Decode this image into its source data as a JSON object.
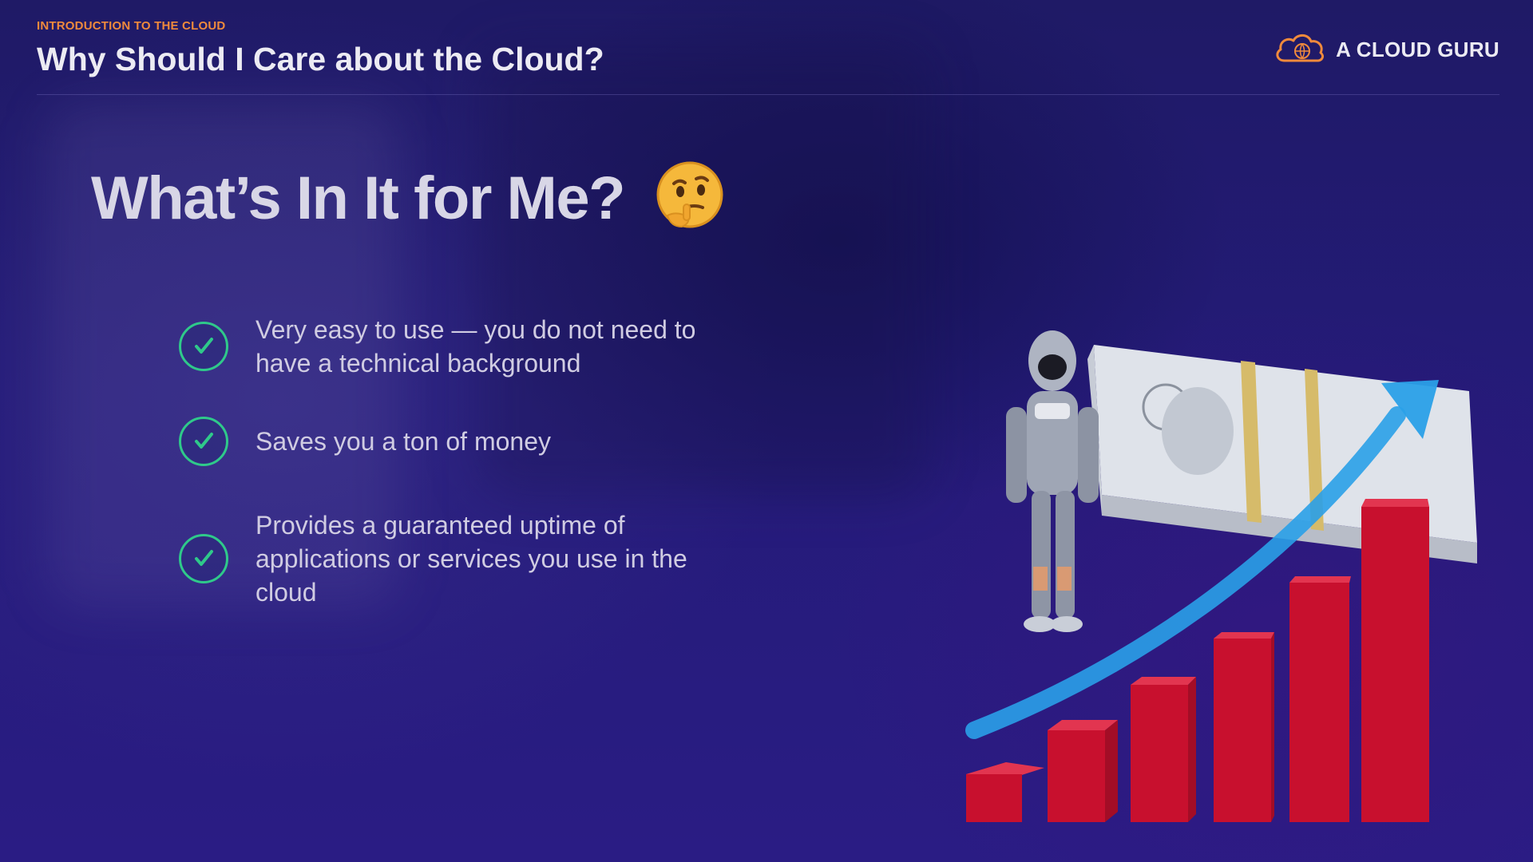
{
  "header": {
    "eyebrow": "INTRODUCTION TO THE CLOUD",
    "title": "Why Should I Care about the Cloud?"
  },
  "brand": {
    "name": "A CLOUD GURU",
    "logo_icon": "cloud-logo-icon",
    "accent_color": "#f08a3c"
  },
  "slide": {
    "heading": "What’s In It for Me?",
    "emoji": "🤔",
    "benefits": [
      {
        "text": "Very easy to use — you do not need to have a technical background",
        "icon": "check-circle-icon"
      },
      {
        "text": "Saves you a ton of money",
        "icon": "check-circle-icon"
      },
      {
        "text": "Provides a guaranteed uptime of applications or services you use in the cloud",
        "icon": "check-circle-icon"
      }
    ]
  },
  "colors": {
    "background": "#241b78",
    "check": "#2fc98a",
    "bars": "#c8102e",
    "arrow": "#2aa0e8"
  },
  "illustration": {
    "icons": [
      "robot-figure-icon",
      "money-stack-icon",
      "growth-arrow-icon",
      "bar-chart-icon"
    ]
  }
}
